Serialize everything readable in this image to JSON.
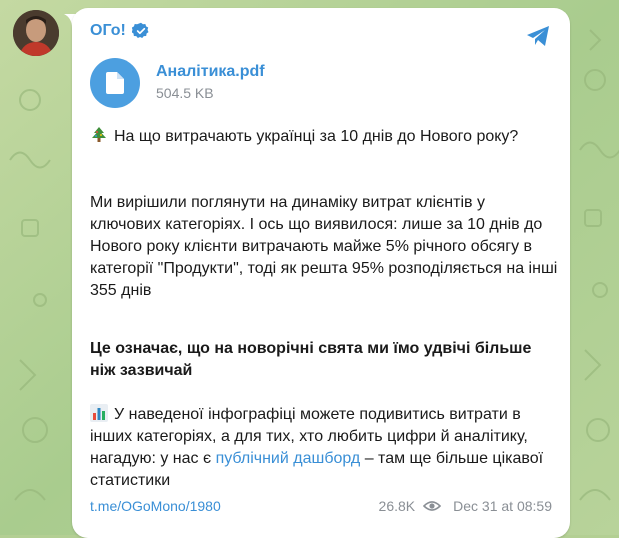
{
  "post": {
    "channel_name": "ОГо!",
    "file": {
      "name": "Аналітика.pdf",
      "size": "504.5 KB"
    },
    "paragraph1": "На що витрачають українці за 10 днів до Нового року?",
    "paragraph2": "Ми вирішили поглянути на динаміку витрат клієнтів у ключових категоріях. І ось що виявилося: лише за 10 днів до Нового року клієнти витрачають майже 5% річного обсягу в категорії \"Продукти\", тоді як решта 95% розподіляється на інші 355 днів",
    "paragraph3": "Це означає, що на новорічні свята ми їмо удвічі більше ніж зазвичай",
    "paragraph4_before": "У наведеної інфографіці можете подивитись витрати в інших категоріях, а для тих, хто любить цифри й аналітику, нагадую: у нас є ",
    "paragraph4_link": "публічний дашборд",
    "paragraph4_after": " – там ще більше цікавої статистики",
    "footer": {
      "link": "t.me/OGoMono/1980",
      "views": "26.8K",
      "date": "Dec 31 at 08:59"
    }
  },
  "icons": {
    "verified": "verified-badge-icon",
    "share": "share-icon",
    "file": "document-icon",
    "tree_emoji": "christmas-tree-icon",
    "chart_emoji": "bar-chart-icon",
    "eye": "eye-icon"
  },
  "colors": {
    "accent": "#3a8fd6",
    "background": "#b3cf93",
    "bubble": "#ffffff",
    "meta": "#8a8f95"
  }
}
